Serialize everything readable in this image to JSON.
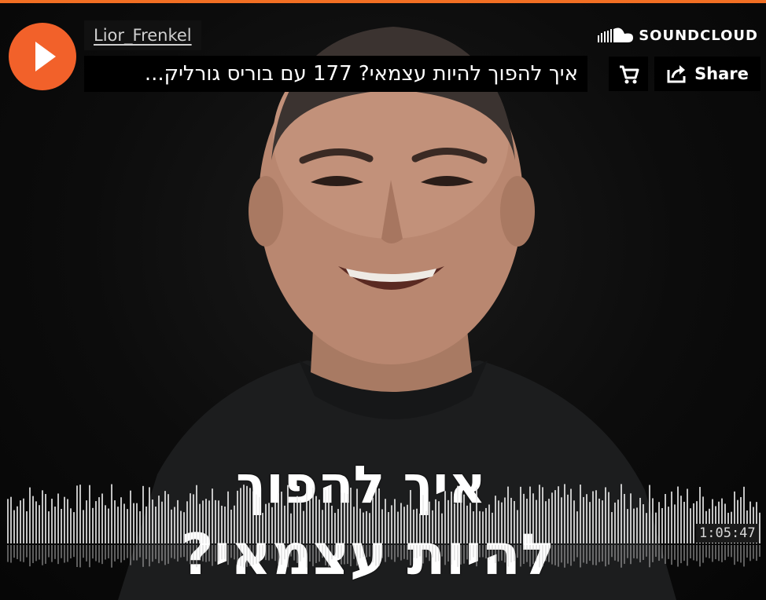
{
  "player": {
    "username": "Lior_Frenkel",
    "track_title": "...איך להפוך להיות עצמאי? 177 עם בוריס גורליק",
    "brand": "SOUNDCLOUD",
    "share_label": "Share",
    "duration": "1:05:47",
    "accent_color": "#f2612a"
  },
  "artwork": {
    "line1": "איך להפוך",
    "line2": "להיות עצמאי?"
  },
  "icons": {
    "play": "play-icon",
    "cart": "cart-icon",
    "share": "share-icon",
    "logo": "soundcloud-cloud-icon"
  }
}
